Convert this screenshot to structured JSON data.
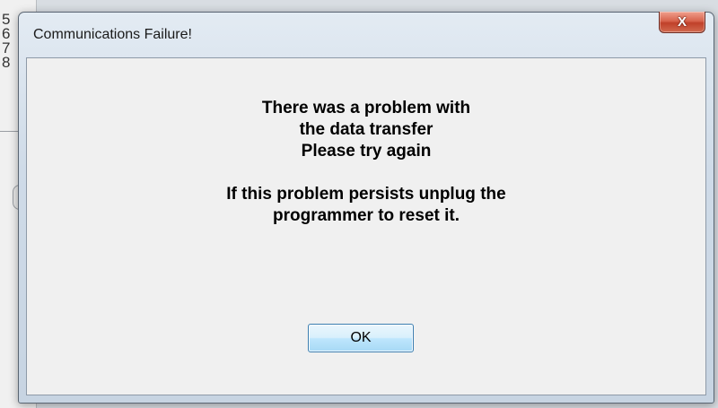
{
  "background_window": {
    "numbers": [
      "5",
      "6",
      "7",
      "8"
    ]
  },
  "dialog": {
    "title": "Communications Failure!",
    "close_icon": "close-x-icon",
    "close_glyph": "X",
    "message_lines_1": [
      "There was a problem with",
      "the data transfer",
      "Please try again"
    ],
    "message_lines_2": [
      "If this problem persists unplug the",
      "programmer to reset it."
    ],
    "ok_label": "OK"
  },
  "colors": {
    "close_button": "#c7442c",
    "ok_button_border": "#3c7fb1",
    "client_background": "#f0f0f0"
  }
}
